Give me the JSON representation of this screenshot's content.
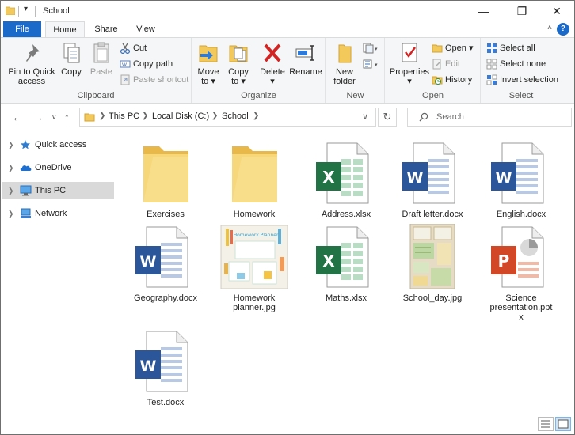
{
  "window": {
    "title": "School",
    "qa_dropdown": "▾",
    "controls": {
      "minimize": "—",
      "maximize": "❐",
      "close": "✕"
    }
  },
  "tabs": [
    {
      "label": "File"
    },
    {
      "label": "Home"
    },
    {
      "label": "Share"
    },
    {
      "label": "View"
    }
  ],
  "help": {
    "label": "?",
    "collapse": "˄"
  },
  "ribbon": {
    "clipboard": {
      "label": "Clipboard",
      "pin": "Pin to Quick access",
      "pin_l1": "Pin to Quick",
      "pin_l2": "access",
      "copy": "Copy",
      "paste": "Paste",
      "cut": "Cut",
      "copy_path": "Copy path",
      "paste_shortcut": "Paste shortcut"
    },
    "organize": {
      "label": "Organize",
      "move_to_l1": "Move",
      "move_to_l2": "to ▾",
      "copy_to_l1": "Copy",
      "copy_to_l2": "to ▾",
      "delete_l1": "Delete",
      "delete_l2": "▾",
      "rename": "Rename"
    },
    "new": {
      "label": "New",
      "new_folder_l1": "New",
      "new_folder_l2": "folder"
    },
    "open": {
      "label": "Open",
      "properties_l1": "Properties",
      "properties_l2": "▾",
      "open": "Open ▾",
      "edit": "Edit",
      "history": "History"
    },
    "select": {
      "label": "Select",
      "select_all": "Select all",
      "select_none": "Select none",
      "invert": "Invert selection"
    }
  },
  "address": {
    "crumbs": [
      "This PC",
      "Local Disk (C:)",
      "School"
    ],
    "search_placeholder": "Search"
  },
  "nav": [
    {
      "label": "Quick access",
      "icon": "star-icon"
    },
    {
      "label": "OneDrive",
      "icon": "cloud-icon"
    },
    {
      "label": "This PC",
      "icon": "computer-icon",
      "selected": true
    },
    {
      "label": "Network",
      "icon": "network-icon"
    }
  ],
  "files": [
    {
      "name": "Exercises",
      "name_l2": "",
      "name_l3": "",
      "type": "folder"
    },
    {
      "name": "Homework",
      "name_l2": "",
      "name_l3": "",
      "type": "folder"
    },
    {
      "name": "Address.xlsx",
      "name_l2": "",
      "name_l3": "",
      "type": "excel"
    },
    {
      "name": "Draft letter.docx",
      "name_l2": "",
      "name_l3": "",
      "type": "word"
    },
    {
      "name": "English.docx",
      "name_l2": "",
      "name_l3": "",
      "type": "word"
    },
    {
      "name": "Geography.docx",
      "name_l2": "",
      "name_l3": "",
      "type": "word"
    },
    {
      "name": "Homework",
      "name_l2": "planner.jpg",
      "name_l3": "",
      "type": "image-planner",
      "thumb_text": "Homework Planner"
    },
    {
      "name": "Maths.xlsx",
      "name_l2": "",
      "name_l3": "",
      "type": "excel"
    },
    {
      "name": "School_day.jpg",
      "name_l2": "",
      "name_l3": "",
      "type": "image-collage"
    },
    {
      "name": "Science",
      "name_l2": "presentation.ppt",
      "name_l3": "x",
      "type": "powerpoint"
    },
    {
      "name": "Test.docx",
      "name_l2": "",
      "name_l3": "",
      "type": "word"
    }
  ],
  "colors": {
    "accent": "#1b6ac9",
    "word": "#2b579a",
    "excel": "#217346",
    "powerpoint": "#d24726",
    "folder": "#f3c95c",
    "selection": "#d9d9d9"
  }
}
